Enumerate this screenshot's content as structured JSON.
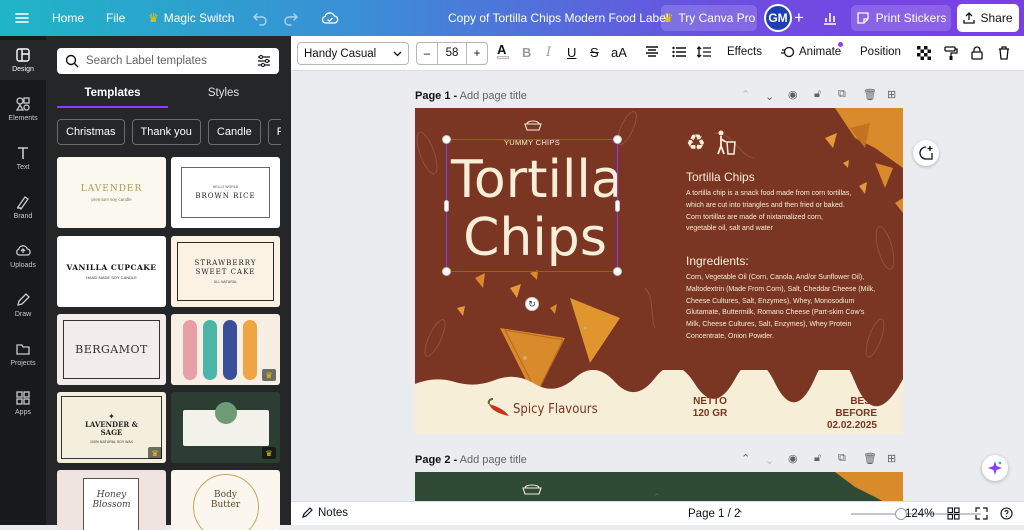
{
  "topbar": {
    "home": "Home",
    "file": "File",
    "magic_switch": "Magic Switch",
    "doc_title": "Copy of Tortilla Chips Modern Food Label",
    "try_pro": "Try Canva Pro",
    "avatar": "GM",
    "print": "Print Stickers",
    "share": "Share"
  },
  "sidebar": {
    "items": [
      {
        "label": "Design",
        "icon": "design-icon"
      },
      {
        "label": "Elements",
        "icon": "elements-icon"
      },
      {
        "label": "Text",
        "icon": "text-icon"
      },
      {
        "label": "Brand",
        "icon": "brand-icon"
      },
      {
        "label": "Uploads",
        "icon": "uploads-icon"
      },
      {
        "label": "Draw",
        "icon": "draw-icon"
      },
      {
        "label": "Projects",
        "icon": "projects-icon"
      },
      {
        "label": "Apps",
        "icon": "apps-icon"
      }
    ]
  },
  "panel": {
    "search_placeholder": "Search Label templates",
    "tabs": [
      "Templates",
      "Styles"
    ],
    "chips": [
      "Christmas",
      "Thank you",
      "Candle",
      "Fo"
    ],
    "templates": [
      {
        "title": "LAVENDER",
        "sub": "premium soy candle"
      },
      {
        "title": "BROWN RICE",
        "sub": "HELLO WORLD"
      },
      {
        "title": "VANILLA CUPCAKE",
        "sub": "HAND MADE SOY CANDLE"
      },
      {
        "title": "STRAWBERRY SWEET CAKE",
        "sub": "ALL NATURAL"
      },
      {
        "title": "BERGAMOT",
        "sub": ""
      },
      {
        "title": "",
        "sub": ""
      },
      {
        "title": "LAVENDER & SAGE",
        "sub": "100% NATURAL SOY WAX"
      },
      {
        "title": "",
        "sub": ""
      },
      {
        "title": "Honey Blossom",
        "sub": ""
      },
      {
        "title": "Body Butter",
        "sub": ""
      }
    ]
  },
  "toolbar": {
    "font": "Handy Casual",
    "size": "58",
    "effects": "Effects",
    "animate": "Animate",
    "position": "Position"
  },
  "pages": [
    {
      "label": "Page 1 -",
      "placeholder": "Add page title"
    },
    {
      "label": "Page 2 -",
      "placeholder": "Add page title"
    }
  ],
  "design": {
    "yummy": "YUMMY CHIPS",
    "title_line1": "Tortilla",
    "title_line2": "Chips",
    "heading1": "Tortilla Chips",
    "para1": "A tortilla chip is a snack food made from corn tortillas, which are cut into triangles and then fried or baked. Corn tortillas are made of nixtamalized corn, vegetable oil, salt and water",
    "heading2": "Ingredients:",
    "para2": "Corn, Vegetable Oil (Corn, Canola, And/or Sunflower Oil), Maltodextrin (Made From Corn), Salt, Cheddar Cheese (Milk, Cheese Cultures, Salt, Enzymes), Whey, Monosodium Glutamate, Buttermilk, Romano Cheese (Part-skim Cow's Milk, Cheese Cultures, Salt, Enzymes), Whey Protein Concentrate, Onion Powder.",
    "spicy": "Spicy Flavours",
    "netto_label": "NETTO",
    "netto_value": "120 GR",
    "best_label": "BEST BEFORE",
    "best_value": "02.02.2025",
    "colors": {
      "brown": "#7b3523",
      "cream": "#f6eed7",
      "chip": "#d98a2b",
      "green": "#2f4a35"
    }
  },
  "bottombar": {
    "notes": "Notes",
    "page_indicator": "Page 1 / 2",
    "zoom": "124%"
  }
}
